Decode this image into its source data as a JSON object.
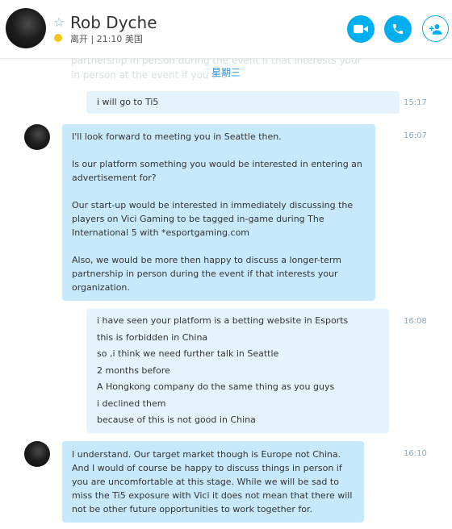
{
  "header": {
    "contact_name": "Rob Dyche",
    "status": "离开 | 21:10 美国",
    "buttons": {
      "video_icon": "video-camera-icon",
      "call_icon": "phone-icon",
      "add_icon": "add-person-icon"
    },
    "colors": {
      "accent": "#00aff0",
      "away": "#f5c518"
    }
  },
  "conversation": {
    "ghost_preview": [
      "partnership in person during the event if that interests your",
      "in person at the event if you are"
    ],
    "day_label": "星期三",
    "messages": [
      {
        "direction": "outgoing",
        "lines": [
          "i will go to Ti5"
        ],
        "time": "15:17"
      },
      {
        "direction": "incoming",
        "paragraphs": [
          "I'll look forward to meeting you in Seattle then.",
          "Is our platform something you would be interested in entering an advertisement for?",
          "Our start-up would be interested in immediately discussing the players on Vici Gaming to be tagged in-game during The International 5 with *esportgaming.com",
          "Also, we would be more then happy to discuss a longer-term partnership in person during the event if that interests your organization."
        ],
        "time": "16:07"
      },
      {
        "direction": "outgoing",
        "lines": [
          "i have seen your platform is a betting website in Esports",
          "this is forbidden in China",
          "so ,i think we need further talk in Seattle",
          "2 months before",
          "A Hongkong company do the same thing as you guys",
          "i declined them",
          "because of this is not good in China"
        ],
        "time": "16:08"
      },
      {
        "direction": "incoming",
        "paragraphs": [
          "I understand. Our target market though is Europe not China.  And I would of course be happy to discuss things in person if you are uncomfortable at this stage. While we will be sad to miss the Ti5 exposure with Vici it does not mean that there will not be other future opportunities to work together for."
        ],
        "time": "16:10"
      }
    ]
  }
}
